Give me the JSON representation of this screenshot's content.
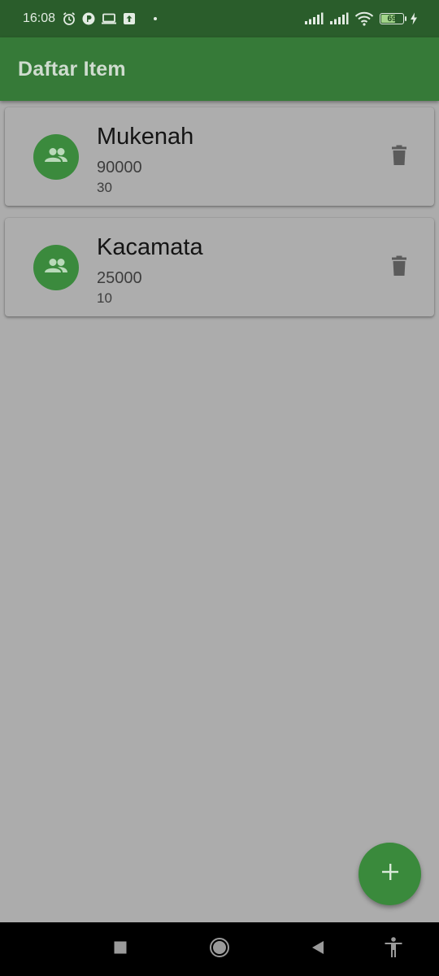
{
  "status_bar": {
    "time": "16:08",
    "battery_level": "69",
    "battery_fraction": 0.69
  },
  "app_bar": {
    "title": "Daftar Item"
  },
  "items": [
    {
      "name": "Mukenah",
      "price": "90000",
      "quantity": "30"
    },
    {
      "name": "Kacamata",
      "price": "25000",
      "quantity": "10"
    }
  ],
  "icons": {
    "avatar": "group-icon",
    "delete": "trash-icon",
    "fab": "plus-icon",
    "nav_recents": "square-icon",
    "nav_home": "circle-icon",
    "nav_back": "triangle-back-icon",
    "nav_accessibility": "accessibility-icon"
  },
  "colors": {
    "status_bar": "#2a5d2b",
    "app_bar": "#367a38",
    "accent": "#3b8a3d",
    "background": "#acacac"
  }
}
